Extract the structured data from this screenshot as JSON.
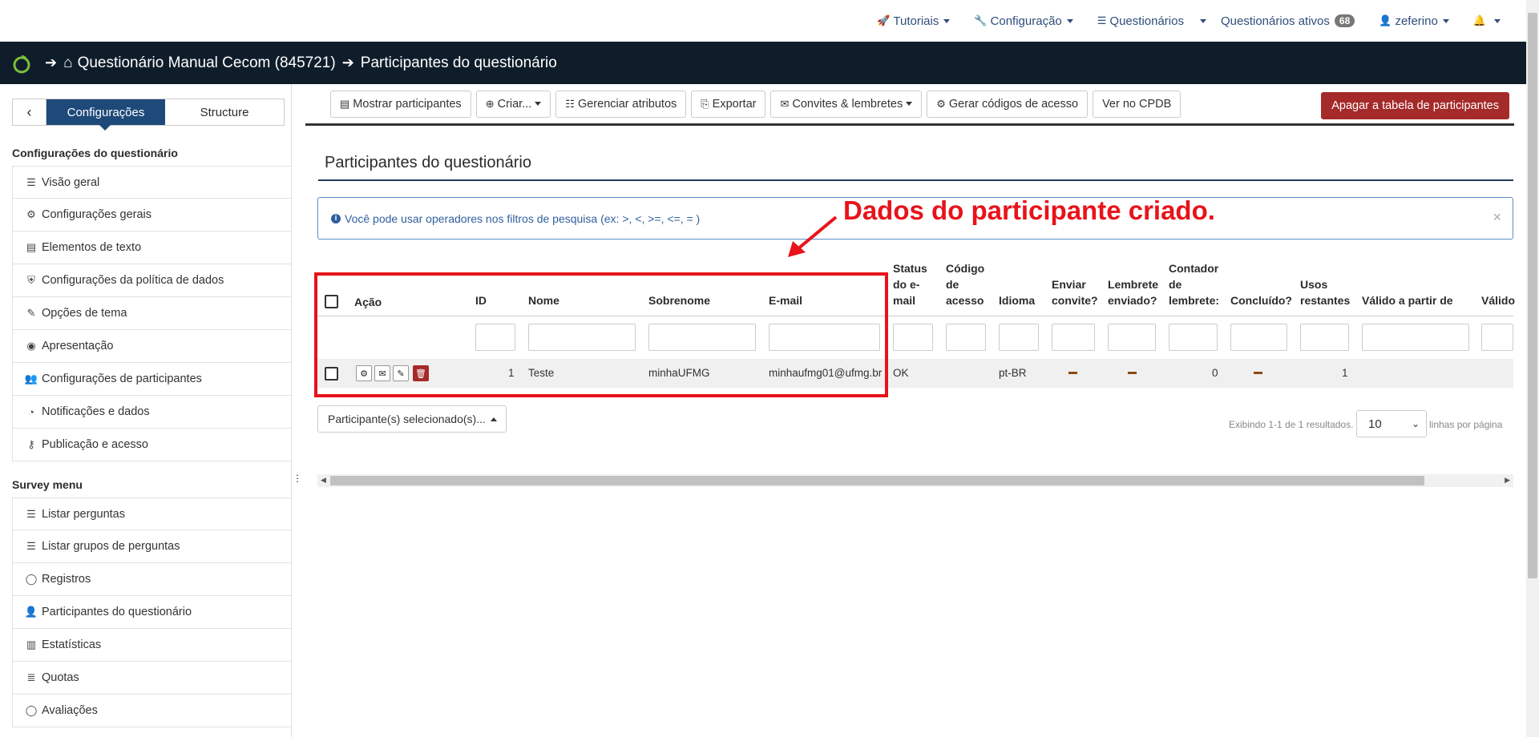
{
  "topnav": {
    "tutorials": "Tutoriais",
    "configuration": "Configuração",
    "surveys": "Questionários",
    "active_surveys": "Questionários ativos",
    "active_count": "68",
    "user": "zeferino"
  },
  "breadcrumb": {
    "survey": "Questionário Manual Cecom (845721)",
    "page": "Participantes do questionário"
  },
  "sidebar": {
    "tab_settings": "Configurações",
    "tab_structure": "Structure",
    "section_settings": "Configurações do questionário",
    "settings_items": [
      {
        "label": "Visão geral",
        "icon": "list-icon"
      },
      {
        "label": "Configurações gerais",
        "icon": "gears-icon"
      },
      {
        "label": "Elementos de texto",
        "icon": "file-text-icon"
      },
      {
        "label": "Configurações da política de dados",
        "icon": "shield-icon"
      },
      {
        "label": "Opções de tema",
        "icon": "brush-icon"
      },
      {
        "label": "Apresentação",
        "icon": "eye-slash-icon"
      },
      {
        "label": "Configurações de participantes",
        "icon": "users-icon"
      },
      {
        "label": "Notificações e dados",
        "icon": "rss-icon"
      },
      {
        "label": "Publicação e acesso",
        "icon": "key-icon"
      }
    ],
    "section_menu": "Survey menu",
    "menu_items": [
      {
        "label": "Listar perguntas",
        "icon": "list-icon"
      },
      {
        "label": "Listar grupos de perguntas",
        "icon": "list-icon"
      },
      {
        "label": "Registros",
        "icon": "comment-icon"
      },
      {
        "label": "Participantes do questionário",
        "icon": "user-icon"
      },
      {
        "label": "Estatísticas",
        "icon": "bar-chart-icon"
      },
      {
        "label": "Quotas",
        "icon": "tasks-icon"
      },
      {
        "label": "Avaliações",
        "icon": "comment-icon"
      }
    ]
  },
  "toolbar": {
    "show_participants": "Mostrar participantes",
    "create": "Criar...",
    "manage_attributes": "Gerenciar atributos",
    "export": "Exportar",
    "invites_reminders": "Convites & lembretes",
    "generate_codes": "Gerar códigos de acesso",
    "view_cpdb": "Ver no CPDB",
    "delete_table": "Apagar a tabela de participantes"
  },
  "main": {
    "title": "Participantes do questionário",
    "alert": "Você pode usar operadores nos filtros de pesquisa (ex: >, <, >=, <=, = )",
    "annotation": "Dados do participante criado."
  },
  "table": {
    "columns": {
      "action": "Ação",
      "id": "ID",
      "name": "Nome",
      "surname": "Sobrenome",
      "email": "E-mail",
      "email_status": [
        "Status",
        "do e-",
        "mail"
      ],
      "access_code": [
        "Código",
        "de",
        "acesso"
      ],
      "language": "Idioma",
      "send_invite": [
        "Enviar",
        "convite?"
      ],
      "reminder_sent": [
        "Lembrete",
        "enviado?"
      ],
      "reminder_count": [
        "Contador",
        "de",
        "lembrete:"
      ],
      "completed": "Concluído?",
      "uses_left": [
        "Usos",
        "restantes"
      ],
      "valid_from": "Válido a partir de",
      "valid_until": "Válido"
    },
    "row": {
      "id": "1",
      "name": "Teste",
      "surname": "minhaUFMG",
      "email": "minhaufmg01@ufmg.br",
      "email_status": "OK",
      "language": "pt-BR",
      "reminder_count": "0",
      "uses_left": "1"
    }
  },
  "footer": {
    "selected": "Participante(s) selecionado(s)...",
    "showing": "Exibindo 1-1 de 1 resultados.",
    "page_size": "10",
    "per_page": "linhas por página"
  },
  "colors": {
    "nav_dark": "#0f1d2b",
    "primary": "#1e4a7a",
    "danger": "#a52a2a",
    "annotation": "#e8131a"
  }
}
